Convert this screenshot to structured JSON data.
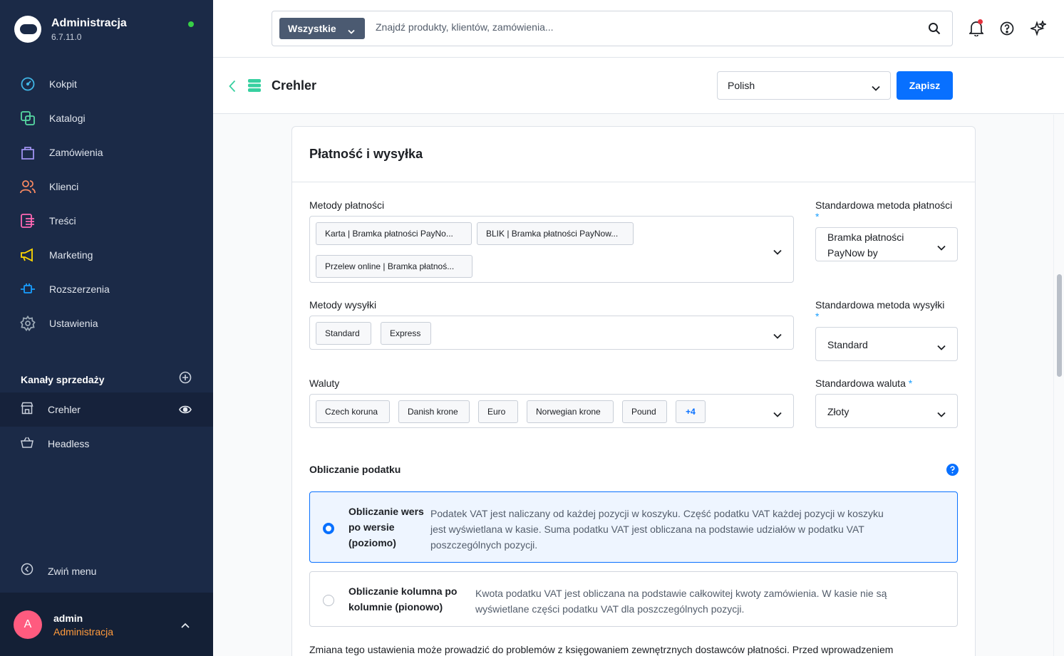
{
  "app": {
    "title": "Administracja",
    "version": "6.7.11.0"
  },
  "nav": [
    {
      "label": "Kokpit",
      "icon": "gauge-icon",
      "color": "#40b6e6"
    },
    {
      "label": "Katalogi",
      "icon": "catalog-icon",
      "color": "#57d9a3"
    },
    {
      "label": "Zamówienia",
      "icon": "shopping-bag-icon",
      "color": "#a092f0"
    },
    {
      "label": "Klienci",
      "icon": "users-icon",
      "color": "#f88962"
    },
    {
      "label": "Treści",
      "icon": "content-icon",
      "color": "#ff68b4"
    },
    {
      "label": "Marketing",
      "icon": "megaphone-icon",
      "color": "#ffd700"
    },
    {
      "label": "Rozszerzenia",
      "icon": "plug-icon",
      "color": "#189eff"
    },
    {
      "label": "Ustawienia",
      "icon": "gear-icon",
      "color": "#9aa8b5"
    }
  ],
  "channels": {
    "title": "Kanały sprzedaży",
    "items": [
      {
        "label": "Crehler",
        "icon": "storefront-icon",
        "active": true
      },
      {
        "label": "Headless",
        "icon": "basket-icon",
        "active": false
      }
    ]
  },
  "collapse_label": "Zwiń menu",
  "user": {
    "initial": "A",
    "name": "admin",
    "role": "Administracja"
  },
  "search": {
    "type_label": "Wszystkie",
    "placeholder": "Znajdź produkty, klientów, zamówienia..."
  },
  "smartbar": {
    "title": "Crehler",
    "language": "Polish",
    "save_label": "Zapisz"
  },
  "card": {
    "title": "Płatność i wysyłka",
    "payment_methods": {
      "label": "Metody płatności",
      "tags": [
        "Karta | Bramka płatności PayNo...",
        "BLIK | Bramka płatności PayNow...",
        "Przelew online | Bramka płatnoś..."
      ]
    },
    "default_payment": {
      "label": "Standardowa metoda płatności",
      "value_line1": "Bramka płatności",
      "value_line2": "PayNow by"
    },
    "shipping_methods": {
      "label": "Metody wysyłki",
      "tags": [
        "Standard",
        "Express"
      ]
    },
    "default_shipping": {
      "label": "Standardowa metoda wysyłki",
      "value": "Standard"
    },
    "currencies": {
      "label": "Waluty",
      "tags": [
        "Czech koruna",
        "Danish krone",
        "Euro",
        "Norwegian krone",
        "Pound"
      ],
      "more": "+4"
    },
    "default_currency": {
      "label": "Standardowa waluta",
      "value": "Złoty"
    },
    "tax": {
      "title": "Obliczanie podatku",
      "options": [
        {
          "title_l1": "Obliczanie wers",
          "title_l2": "po wersie",
          "title_l3": "(poziomo)",
          "desc_l1": "Podatek VAT jest naliczany od każdej pozycji w koszyku. Część podatku VAT każdej pozycji w koszyku",
          "desc_l2": "jest wyświetlana w kasie. Suma podatku VAT jest obliczana na podstawie udziałów w podatku VAT",
          "desc_l3": "poszczególnych pozycji.",
          "selected": true
        },
        {
          "title_l1": "Obliczanie kolumna po",
          "title_l2": "kolumnie (pionowo)",
          "desc_l1": "Kwota podatku VAT jest obliczana na podstawie całkowitej kwoty zamówienia. W kasie nie są",
          "desc_l2": "wyświetlane części podatku VAT dla poszczególnych pozycji.",
          "selected": false
        }
      ],
      "warning": "Zmiana tego ustawienia może prowadzić do problemów z księgowaniem zewnętrznych dostawców płatności. Przed wprowadzeniem"
    }
  },
  "colors": {
    "sidebar": "#1b2a47",
    "primary": "#0870ff",
    "status_online": "#37d046",
    "avatar": "#ff5b7f",
    "role": "#ff9a3c"
  }
}
